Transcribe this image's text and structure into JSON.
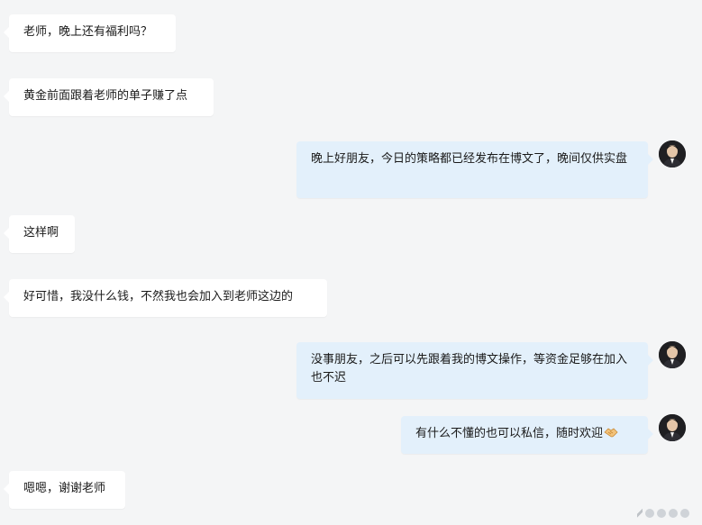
{
  "messages": [
    {
      "side": "left",
      "text": "老师，晚上还有福利吗？"
    },
    {
      "side": "left",
      "text": "黄金前面跟着老师的单子赚了点"
    },
    {
      "side": "right",
      "text": "晚上好朋友，今日的策略都已经发布在博文了，晚间仅供实盘"
    },
    {
      "side": "left",
      "text": "这样啊"
    },
    {
      "side": "left",
      "text": "好可惜，我没什么钱，不然我也会加入到老师这边的"
    },
    {
      "side": "right",
      "text": "没事朋友，之后可以先跟着我的博文操作，等资金足够在加入也不迟"
    },
    {
      "side": "right",
      "text": "有什么不懂的也可以私信，随时欢迎",
      "emoji": "handshake-emoji"
    },
    {
      "side": "left",
      "text": "嗯嗯，谢谢老师"
    }
  ],
  "colors": {
    "background": "#f4f5f6",
    "left_bubble": "#ffffff",
    "right_bubble": "#e3f0fb",
    "text": "#1a1a1a"
  }
}
